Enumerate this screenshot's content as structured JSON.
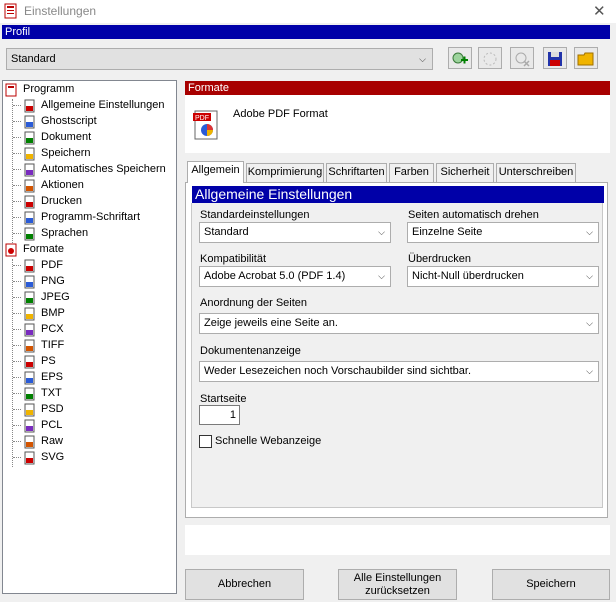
{
  "window": {
    "title": "Einstellungen",
    "close_glyph": "✕"
  },
  "profile": {
    "header": "Profil",
    "selected": "Standard"
  },
  "toolbar": {
    "add_icon": "add-profile-icon",
    "buttons": [
      "add-profile",
      "rename-profile",
      "delete-profile",
      "save-profile",
      "open-profile"
    ]
  },
  "tree": {
    "program": {
      "label": "Programm",
      "items": [
        "Allgemeine Einstellungen",
        "Ghostscript",
        "Dokument",
        "Speichern",
        "Automatisches Speichern",
        "Aktionen",
        "Drucken",
        "Programm-Schriftart",
        "Sprachen"
      ]
    },
    "formats": {
      "label": "Formate",
      "items": [
        "PDF",
        "PNG",
        "JPEG",
        "BMP",
        "PCX",
        "TIFF",
        "PS",
        "EPS",
        "TXT",
        "PSD",
        "PCL",
        "Raw",
        "SVG"
      ]
    }
  },
  "formats_panel": {
    "header": "Formate",
    "format_name": "Adobe PDF Format"
  },
  "tabs": [
    "Allgemein",
    "Komprimierung",
    "Schriftarten",
    "Farben",
    "Sicherheit",
    "Unterschreiben"
  ],
  "general": {
    "section_title": "Allgemeine Einstellungen",
    "standard_label": "Standardeinstellungen",
    "standard_value": "Standard",
    "rotate_label": "Seiten automatisch drehen",
    "rotate_value": "Einzelne Seite",
    "compat_label": "Kompatibilität",
    "compat_value": "Adobe Acrobat 5.0 (PDF 1.4)",
    "overprint_label": "Überdrucken",
    "overprint_value": "Nicht-Null überdrucken",
    "layout_label": "Anordnung der Seiten",
    "layout_value": "Zeige jeweils eine Seite an.",
    "display_label": "Dokumentenanzeige",
    "display_value": "Weder Lesezeichen noch Vorschaubilder sind sichtbar.",
    "startpage_label": "Startseite",
    "startpage_value": "1",
    "fastweb_label": "Schnelle Webanzeige",
    "fastweb_checked": false
  },
  "buttons": {
    "cancel": "Abbrechen",
    "reset_line1": "Alle Einstellungen",
    "reset_line2": "zurücksetzen",
    "save": "Speichern"
  }
}
